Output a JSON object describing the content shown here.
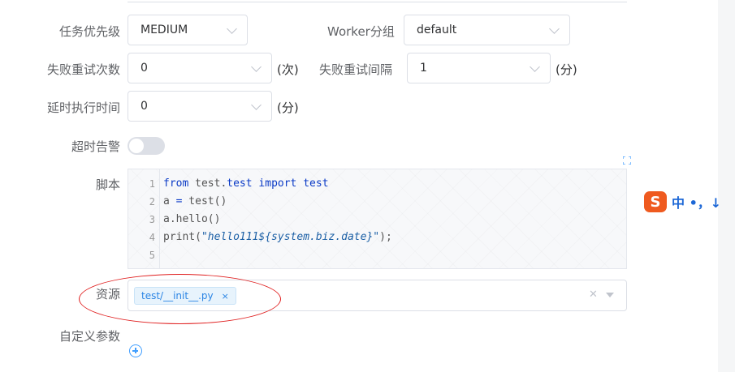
{
  "form": {
    "priority": {
      "label": "任务优先级",
      "value": "MEDIUM"
    },
    "worker_group": {
      "label": "Worker分组",
      "value": "default"
    },
    "retry_times": {
      "label": "失败重试次数",
      "value": "0",
      "unit": "(次)"
    },
    "retry_interval": {
      "label": "失败重试间隔",
      "value": "1",
      "unit": "(分)"
    },
    "delay_time": {
      "label": "延时执行时间",
      "value": "0",
      "unit": "(分)"
    },
    "timeout_alarm": {
      "label": "超时告警",
      "enabled": false
    },
    "script": {
      "label": "脚本",
      "line_numbers": [
        "1",
        "2",
        "3",
        "4",
        "5"
      ],
      "lines": [
        [
          "from",
          " test.",
          "test",
          " ",
          "import",
          " test"
        ],
        [
          "a ",
          "=",
          " test()"
        ],
        [
          "a.hello()"
        ],
        [
          "print(",
          "\"hello111${system.biz.date}\"",
          ");"
        ],
        [
          ""
        ]
      ]
    },
    "resources": {
      "label": "资源",
      "tags": [
        "test/__init__.py"
      ],
      "tag_close": "×"
    },
    "custom_params": {
      "label": "自定义参数"
    }
  },
  "ime": {
    "chars": "中 •，↓"
  },
  "colors": {
    "primary": "#409eff",
    "highlight_ellipse": "#e02020",
    "switch_off": "#dcdfe6"
  }
}
